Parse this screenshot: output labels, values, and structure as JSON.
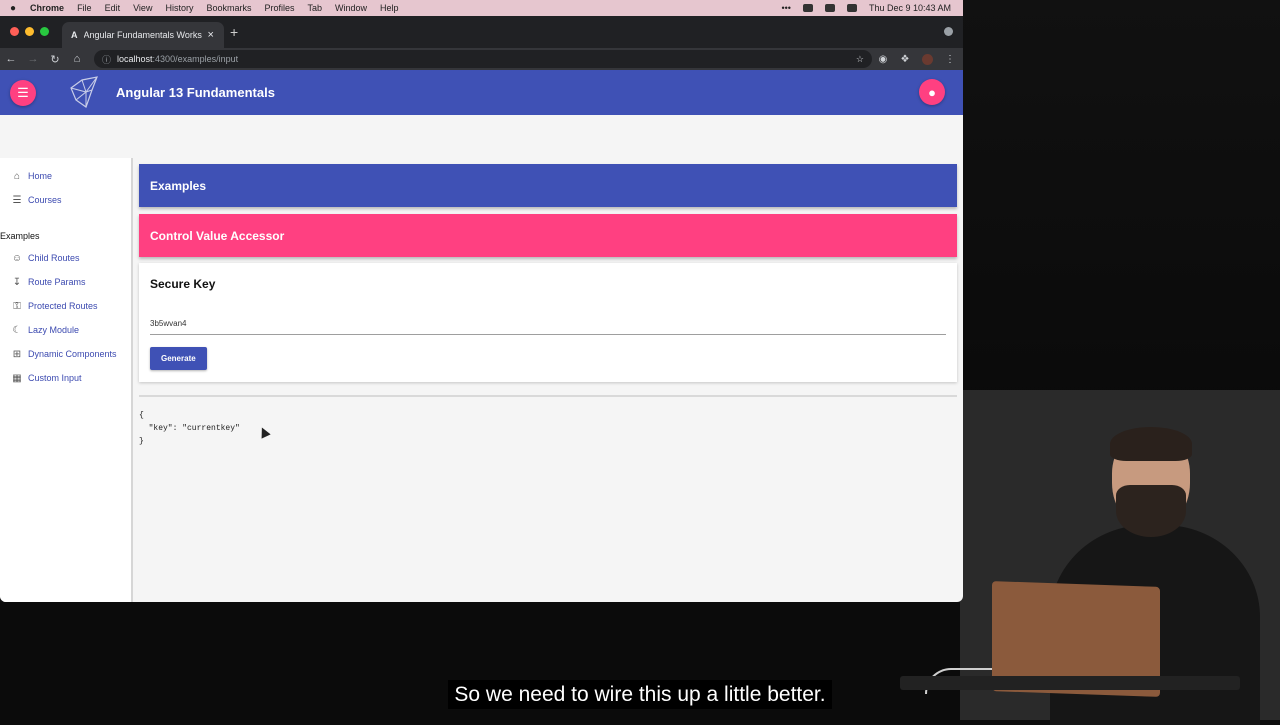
{
  "mac_menubar": {
    "app": "Chrome",
    "menus": [
      "File",
      "Edit",
      "View",
      "History",
      "Bookmarks",
      "Profiles",
      "Tab",
      "Window",
      "Help"
    ],
    "datetime": "Thu Dec 9  10:43 AM"
  },
  "browser": {
    "tab": {
      "favicon": "A",
      "title": "Angular Fundamentals Worksh"
    },
    "url_host": "localhost",
    "url_path": ":4300/examples/input"
  },
  "app": {
    "title": "Angular 13 Fundamentals",
    "accent": "#ff4081",
    "primary": "#3f51b5"
  },
  "sidenav": {
    "top_items": [
      {
        "label": "Home",
        "icon": "home-icon"
      },
      {
        "label": "Courses",
        "icon": "list-icon"
      }
    ],
    "section_label": "Examples",
    "example_items": [
      {
        "label": "Child Routes",
        "icon": "child-icon"
      },
      {
        "label": "Route Params",
        "icon": "download-box-icon"
      },
      {
        "label": "Protected Routes",
        "icon": "key-icon"
      },
      {
        "label": "Lazy Module",
        "icon": "sleep-icon"
      },
      {
        "label": "Dynamic Components",
        "icon": "add-box-icon"
      },
      {
        "label": "Custom Input",
        "icon": "dashboard-icon"
      }
    ]
  },
  "main": {
    "primary_banner": "Examples",
    "accent_banner": "Control Value Accessor",
    "card": {
      "title": "Secure Key",
      "input_value": "3b5wvan4",
      "button_label": "Generate"
    },
    "json_output": "{\n  \"key\": \"currentkey\"\n}"
  },
  "caption": "So we need to wire this up a little better."
}
